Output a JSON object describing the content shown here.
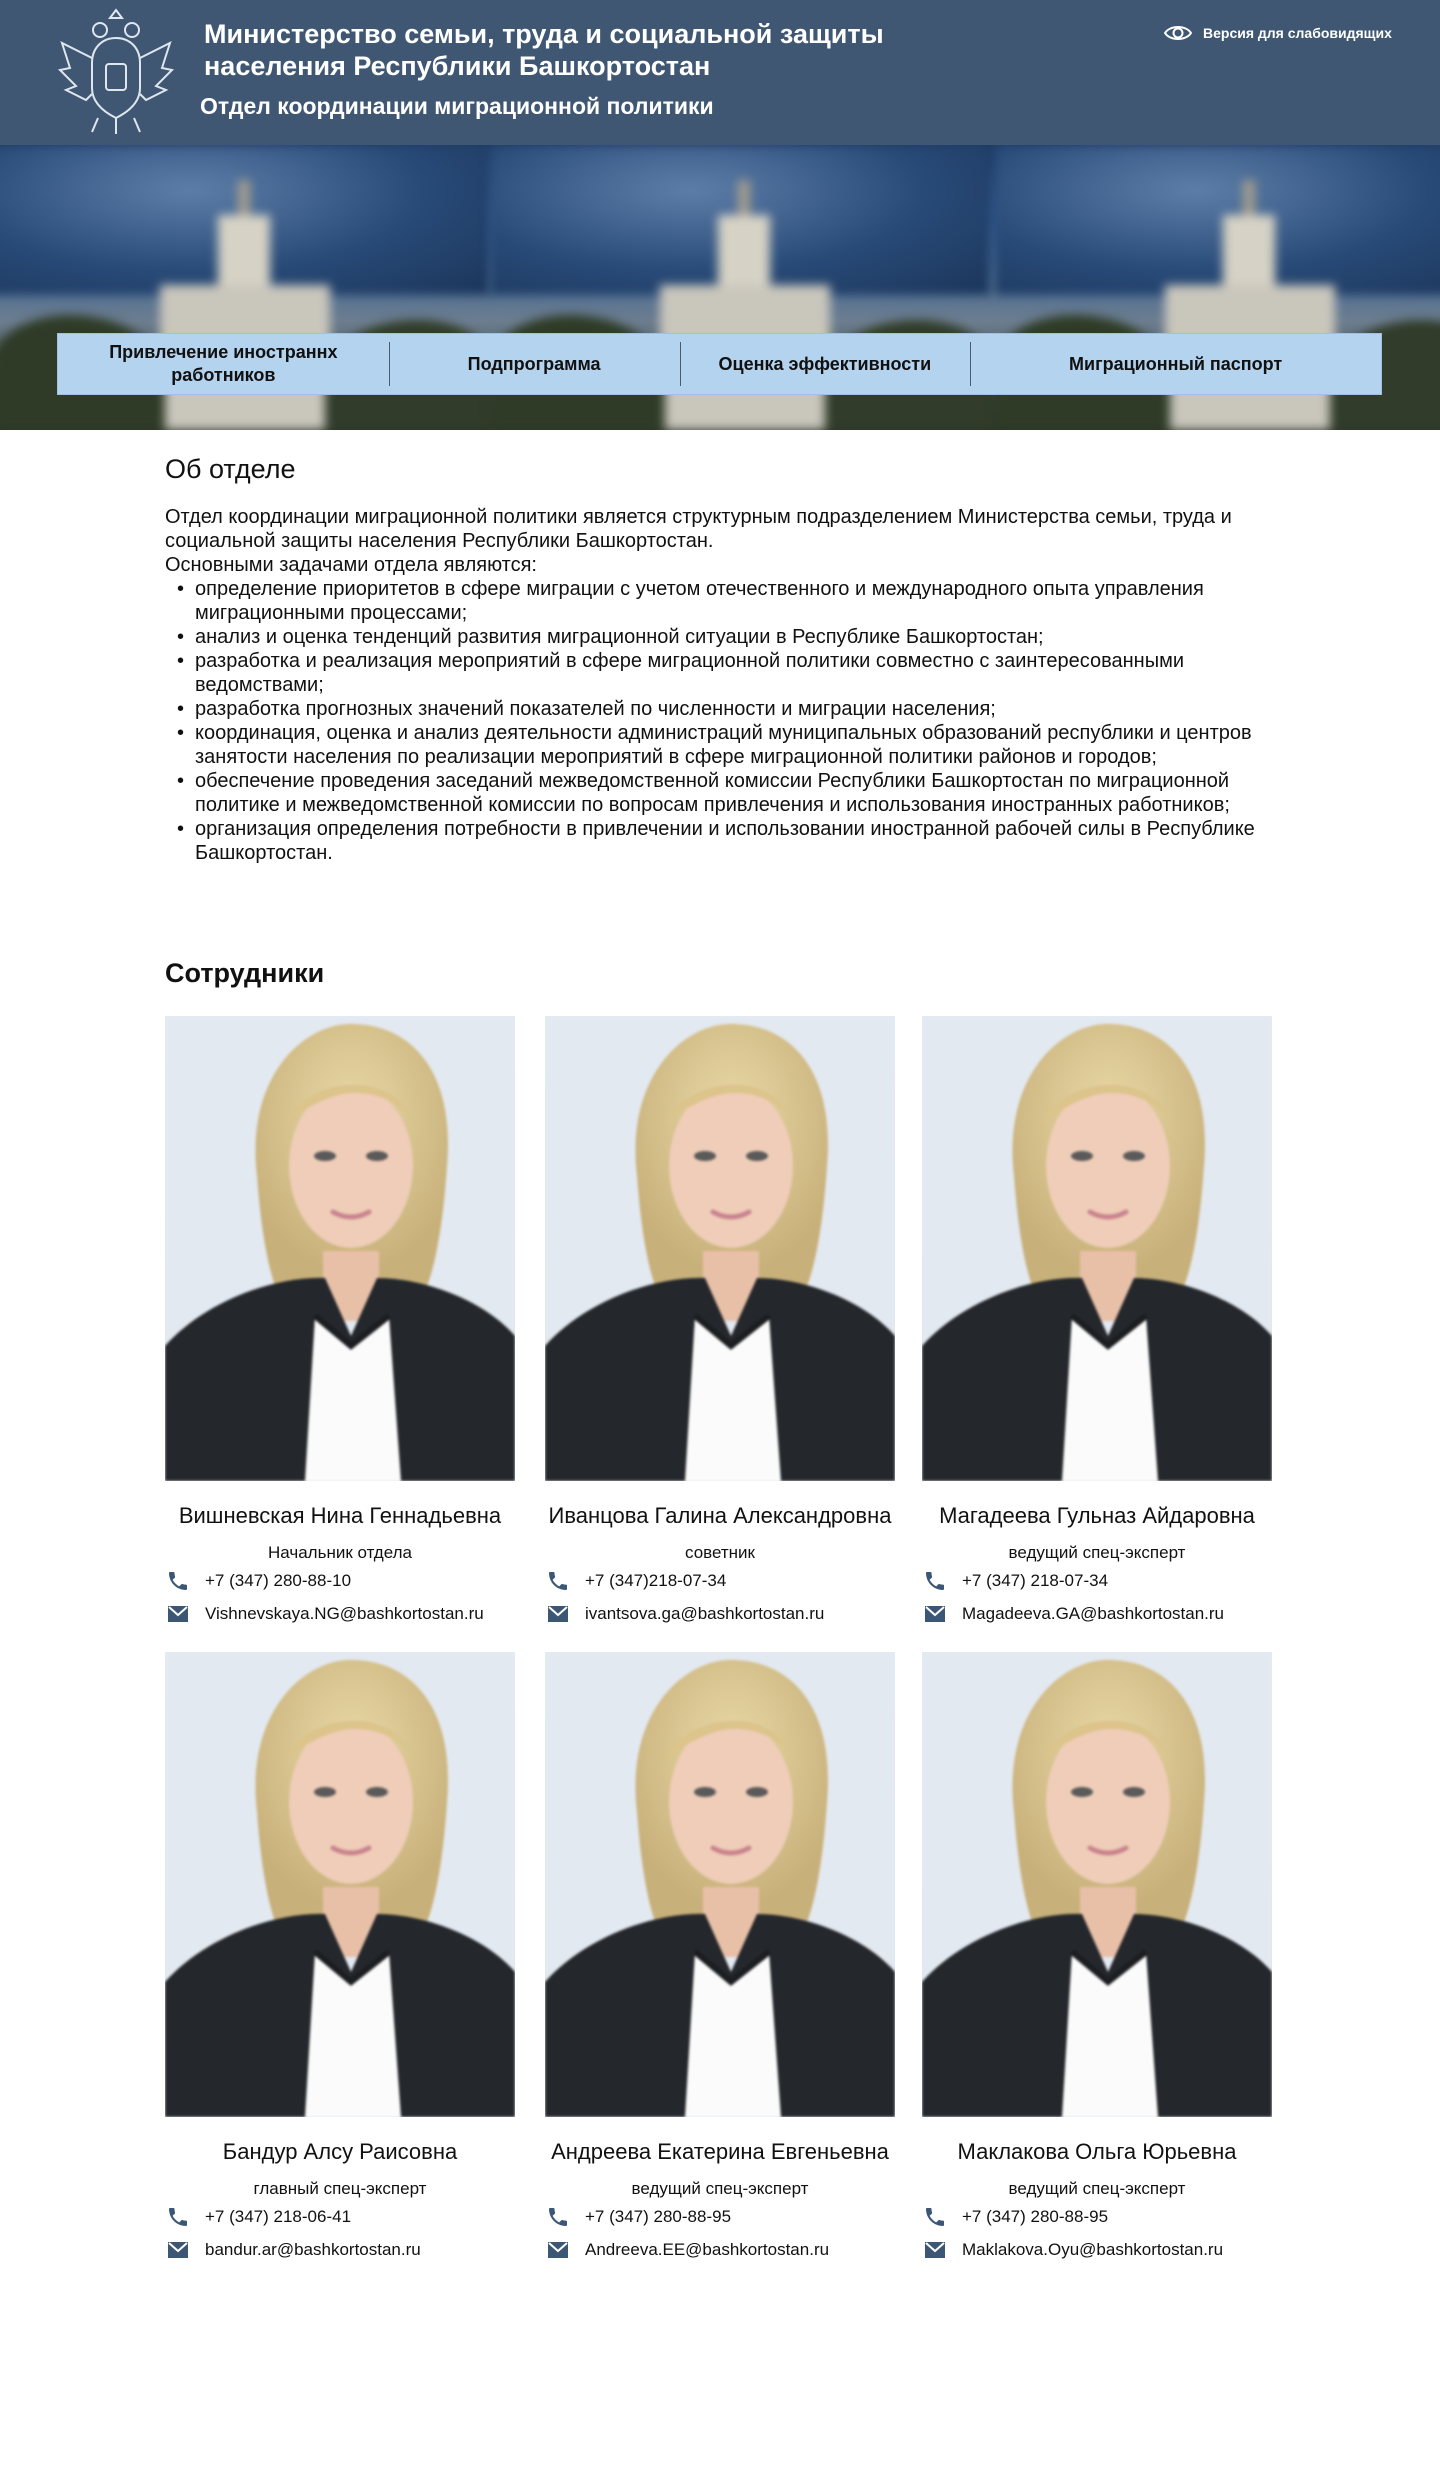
{
  "header": {
    "ministry_line1": "Министерство семьи, труда и социальной защиты",
    "ministry_line2": "населения Республики Башкортостан",
    "department": "Отдел координации миграционной политики",
    "accessibility_label": "Версия для слабовидящих"
  },
  "nav": {
    "items": [
      {
        "label": "Привлечение иностраннх работников"
      },
      {
        "label": "Подпрограмма"
      },
      {
        "label": "Оценка эффективности"
      },
      {
        "label": "Миграционный паспорт"
      }
    ]
  },
  "about": {
    "title": "Об отделе",
    "intro": "Отдел координации миграционной политики является структурным подразделением Министерства семьи, труда и социальной защиты населения Республики Башкортостан.",
    "tasks_intro": "Основными задачами отдела являются:",
    "tasks": [
      "определение приоритетов в сфере миграции с учетом отечественного и международного опыта управления миграционными процессами;",
      "анализ и оценка тенденций развития миграционной ситуации в Республике Башкортостан;",
      "разработка и реализация мероприятий в сфере миграционной политики совместно с заинтересованными ведомствами;",
      "разработка прогнозных значений показателей по численности и миграции населения;",
      "координация, оценка и анализ деятельности администраций муниципальных образований республики и центров занятости населения по реализации мероприятий в сфере миграционной политики районов и городов;",
      "обеспечение проведения заседаний межведомственной комиссии Республики Башкортостан по миграционной политике и межведомственной комиссии по вопросам привлечения и использования иностранных работников;",
      "организация определения потребности в привлечении и использовании иностранной рабочей силы в Республике Башкортостан."
    ]
  },
  "staff": {
    "title": "Сотрудники",
    "members": [
      {
        "name": "Вишневская Нина Геннадьевна",
        "role": "Начальник отдела",
        "phone": "+7 (347) 280-88-10",
        "email": "Vishnevskaya.NG@bashkortostan.ru"
      },
      {
        "name": "Иванцова Галина Александровна",
        "role": "советник",
        "phone": "+7 (347)218-07-34",
        "email": "ivantsova.ga@bashkortostan.ru"
      },
      {
        "name": "Магадеева Гульназ Айдаровна",
        "role": "ведущий спец-эксперт",
        "phone": "+7 (347) 218-07-34",
        "email": "Magadeeva.GA@bashkortostan.ru"
      },
      {
        "name": "Бандур Алсу Раисовна",
        "role": "главный спец-эксперт",
        "phone": "+7 (347) 218-06-41",
        "email": "bandur.ar@bashkortostan.ru"
      },
      {
        "name": "Андреева Екатерина Евгеньевна",
        "role": "ведущий спец-эксперт",
        "phone": "+7 (347) 280-88-95",
        "email": "Andreeva.EE@bashkortostan.ru"
      },
      {
        "name": "Маклакова Ольга Юрьевна",
        "role": "ведущий спец-эксперт",
        "phone": "+7 (347) 280-88-95",
        "email": "Maklakova.Oyu@bashkortostan.ru"
      }
    ]
  },
  "colors": {
    "header_bg": "#3f5773",
    "nav_bg": "#b4d3ef",
    "icon_color": "#3c5675"
  }
}
